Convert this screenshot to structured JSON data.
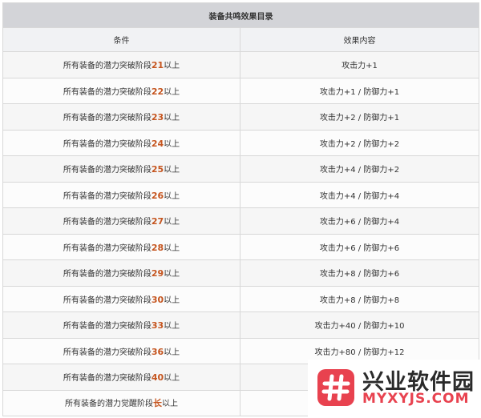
{
  "table": {
    "title": "装备共鸣效果目录",
    "headers": {
      "condition": "条件",
      "effect": "效果内容"
    },
    "rows": [
      {
        "prefix": "所有装备的潜力突破阶段",
        "level": "21",
        "suffix": "以上",
        "effect": "攻击力+1"
      },
      {
        "prefix": "所有装备的潜力突破阶段",
        "level": "22",
        "suffix": "以上",
        "effect": "攻击力+1 / 防御力+1"
      },
      {
        "prefix": "所有装备的潜力突破阶段",
        "level": "23",
        "suffix": "以上",
        "effect": "攻击力+2 / 防御力+1"
      },
      {
        "prefix": "所有装备的潜力突破阶段",
        "level": "24",
        "suffix": "以上",
        "effect": "攻击力+2 / 防御力+2"
      },
      {
        "prefix": "所有装备的潜力突破阶段",
        "level": "25",
        "suffix": "以上",
        "effect": "攻击力+4 / 防御力+2"
      },
      {
        "prefix": "所有装备的潜力突破阶段",
        "level": "26",
        "suffix": "以上",
        "effect": "攻击力+4 / 防御力+4"
      },
      {
        "prefix": "所有装备的潜力突破阶段",
        "level": "27",
        "suffix": "以上",
        "effect": "攻击力+6 / 防御力+4"
      },
      {
        "prefix": "所有装备的潜力突破阶段",
        "level": "28",
        "suffix": "以上",
        "effect": "攻击力+6 / 防御力+6"
      },
      {
        "prefix": "所有装备的潜力突破阶段",
        "level": "29",
        "suffix": "以上",
        "effect": "攻击力+8 / 防御力+6"
      },
      {
        "prefix": "所有装备的潜力突破阶段",
        "level": "30",
        "suffix": "以上",
        "effect": "攻击力+8 / 防御力+8"
      },
      {
        "prefix": "所有装备的潜力突破阶段",
        "level": "33",
        "suffix": "以上",
        "effect": "攻击力+40 / 防御力+10"
      },
      {
        "prefix": "所有装备的潜力突破阶段",
        "level": "36",
        "suffix": "以上",
        "effect": "攻击力+80 / 防御力+12"
      },
      {
        "prefix": "所有装备的潜力突破阶段",
        "level": "40",
        "suffix": "以上",
        "effect": ""
      },
      {
        "prefix": "所有装备的潜力觉醒阶段",
        "level": "长",
        "suffix": "以上",
        "effect": ""
      }
    ]
  },
  "watermark": {
    "name_cn": "兴业软件园",
    "name_en": "MYXYJS.COM",
    "logo_icon": "hash-icon",
    "color": "#e8424f"
  }
}
